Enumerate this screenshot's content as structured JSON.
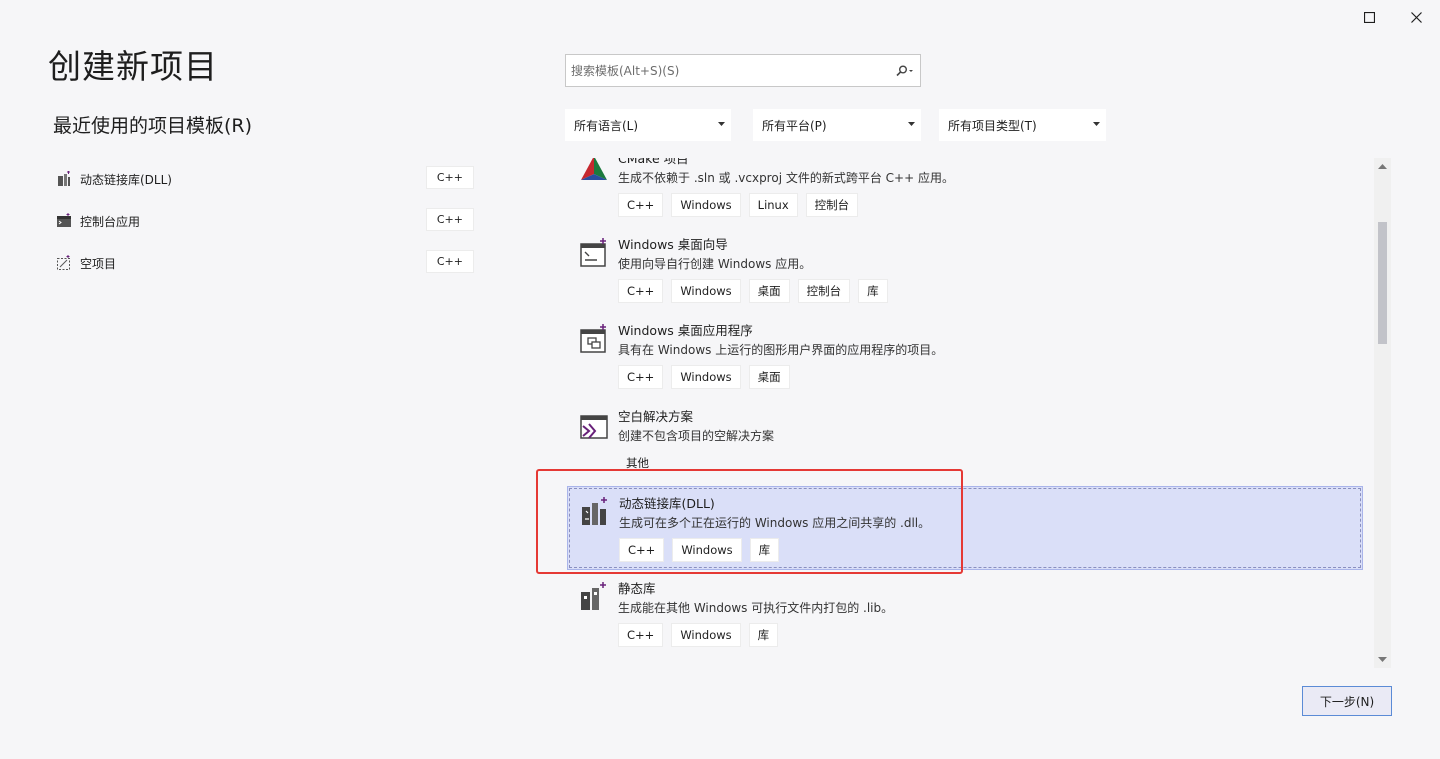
{
  "window": {
    "maximize_icon": "maximize-icon",
    "close_icon": "close-icon"
  },
  "title": "创建新项目",
  "recent": {
    "heading": "最近使用的项目模板(R)",
    "items": [
      {
        "label": "动态链接库(DLL)",
        "tag": "C++",
        "icon": "dll-icon"
      },
      {
        "label": "控制台应用",
        "tag": "C++",
        "icon": "console-icon"
      },
      {
        "label": "空项目",
        "tag": "C++",
        "icon": "empty-project-icon"
      }
    ]
  },
  "search": {
    "placeholder": "搜索模板(Alt+S)(S)",
    "icon": "search-icon"
  },
  "filters": {
    "language": "所有语言(L)",
    "platform": "所有平台(P)",
    "project_type": "所有项目类型(T)"
  },
  "templates": [
    {
      "name": "CMake 项目",
      "desc": "生成不依赖于 .sln 或 .vcxproj 文件的新式跨平台 C++ 应用。",
      "tags": [
        "C++",
        "Windows",
        "Linux",
        "控制台"
      ],
      "icon": "cmake-icon"
    },
    {
      "name": "Windows 桌面向导",
      "desc": "使用向导自行创建 Windows 应用。",
      "tags": [
        "C++",
        "Windows",
        "桌面",
        "控制台",
        "库"
      ],
      "icon": "wizard-icon"
    },
    {
      "name": "Windows 桌面应用程序",
      "desc": "具有在 Windows 上运行的图形用户界面的应用程序的项目。",
      "tags": [
        "C++",
        "Windows",
        "桌面"
      ],
      "icon": "desktop-app-icon"
    },
    {
      "name": "空白解决方案",
      "desc": "创建不包含项目的空解决方案",
      "tags": [
        "其他"
      ],
      "icon": "blank-solution-icon"
    },
    {
      "name": "动态链接库(DLL)",
      "desc": "生成可在多个正在运行的 Windows 应用之间共享的 .dll。",
      "tags": [
        "C++",
        "Windows",
        "库"
      ],
      "icon": "dll-icon",
      "selected": true
    },
    {
      "name": "静态库",
      "desc": "生成能在其他 Windows 可执行文件内打包的 .lib。",
      "tags": [
        "C++",
        "Windows",
        "库"
      ],
      "icon": "static-lib-icon"
    }
  ],
  "next_button": "下一步(N)",
  "colors": {
    "accent": "#68217a",
    "selection_bg": "#dadff8",
    "highlight": "#e53935"
  }
}
